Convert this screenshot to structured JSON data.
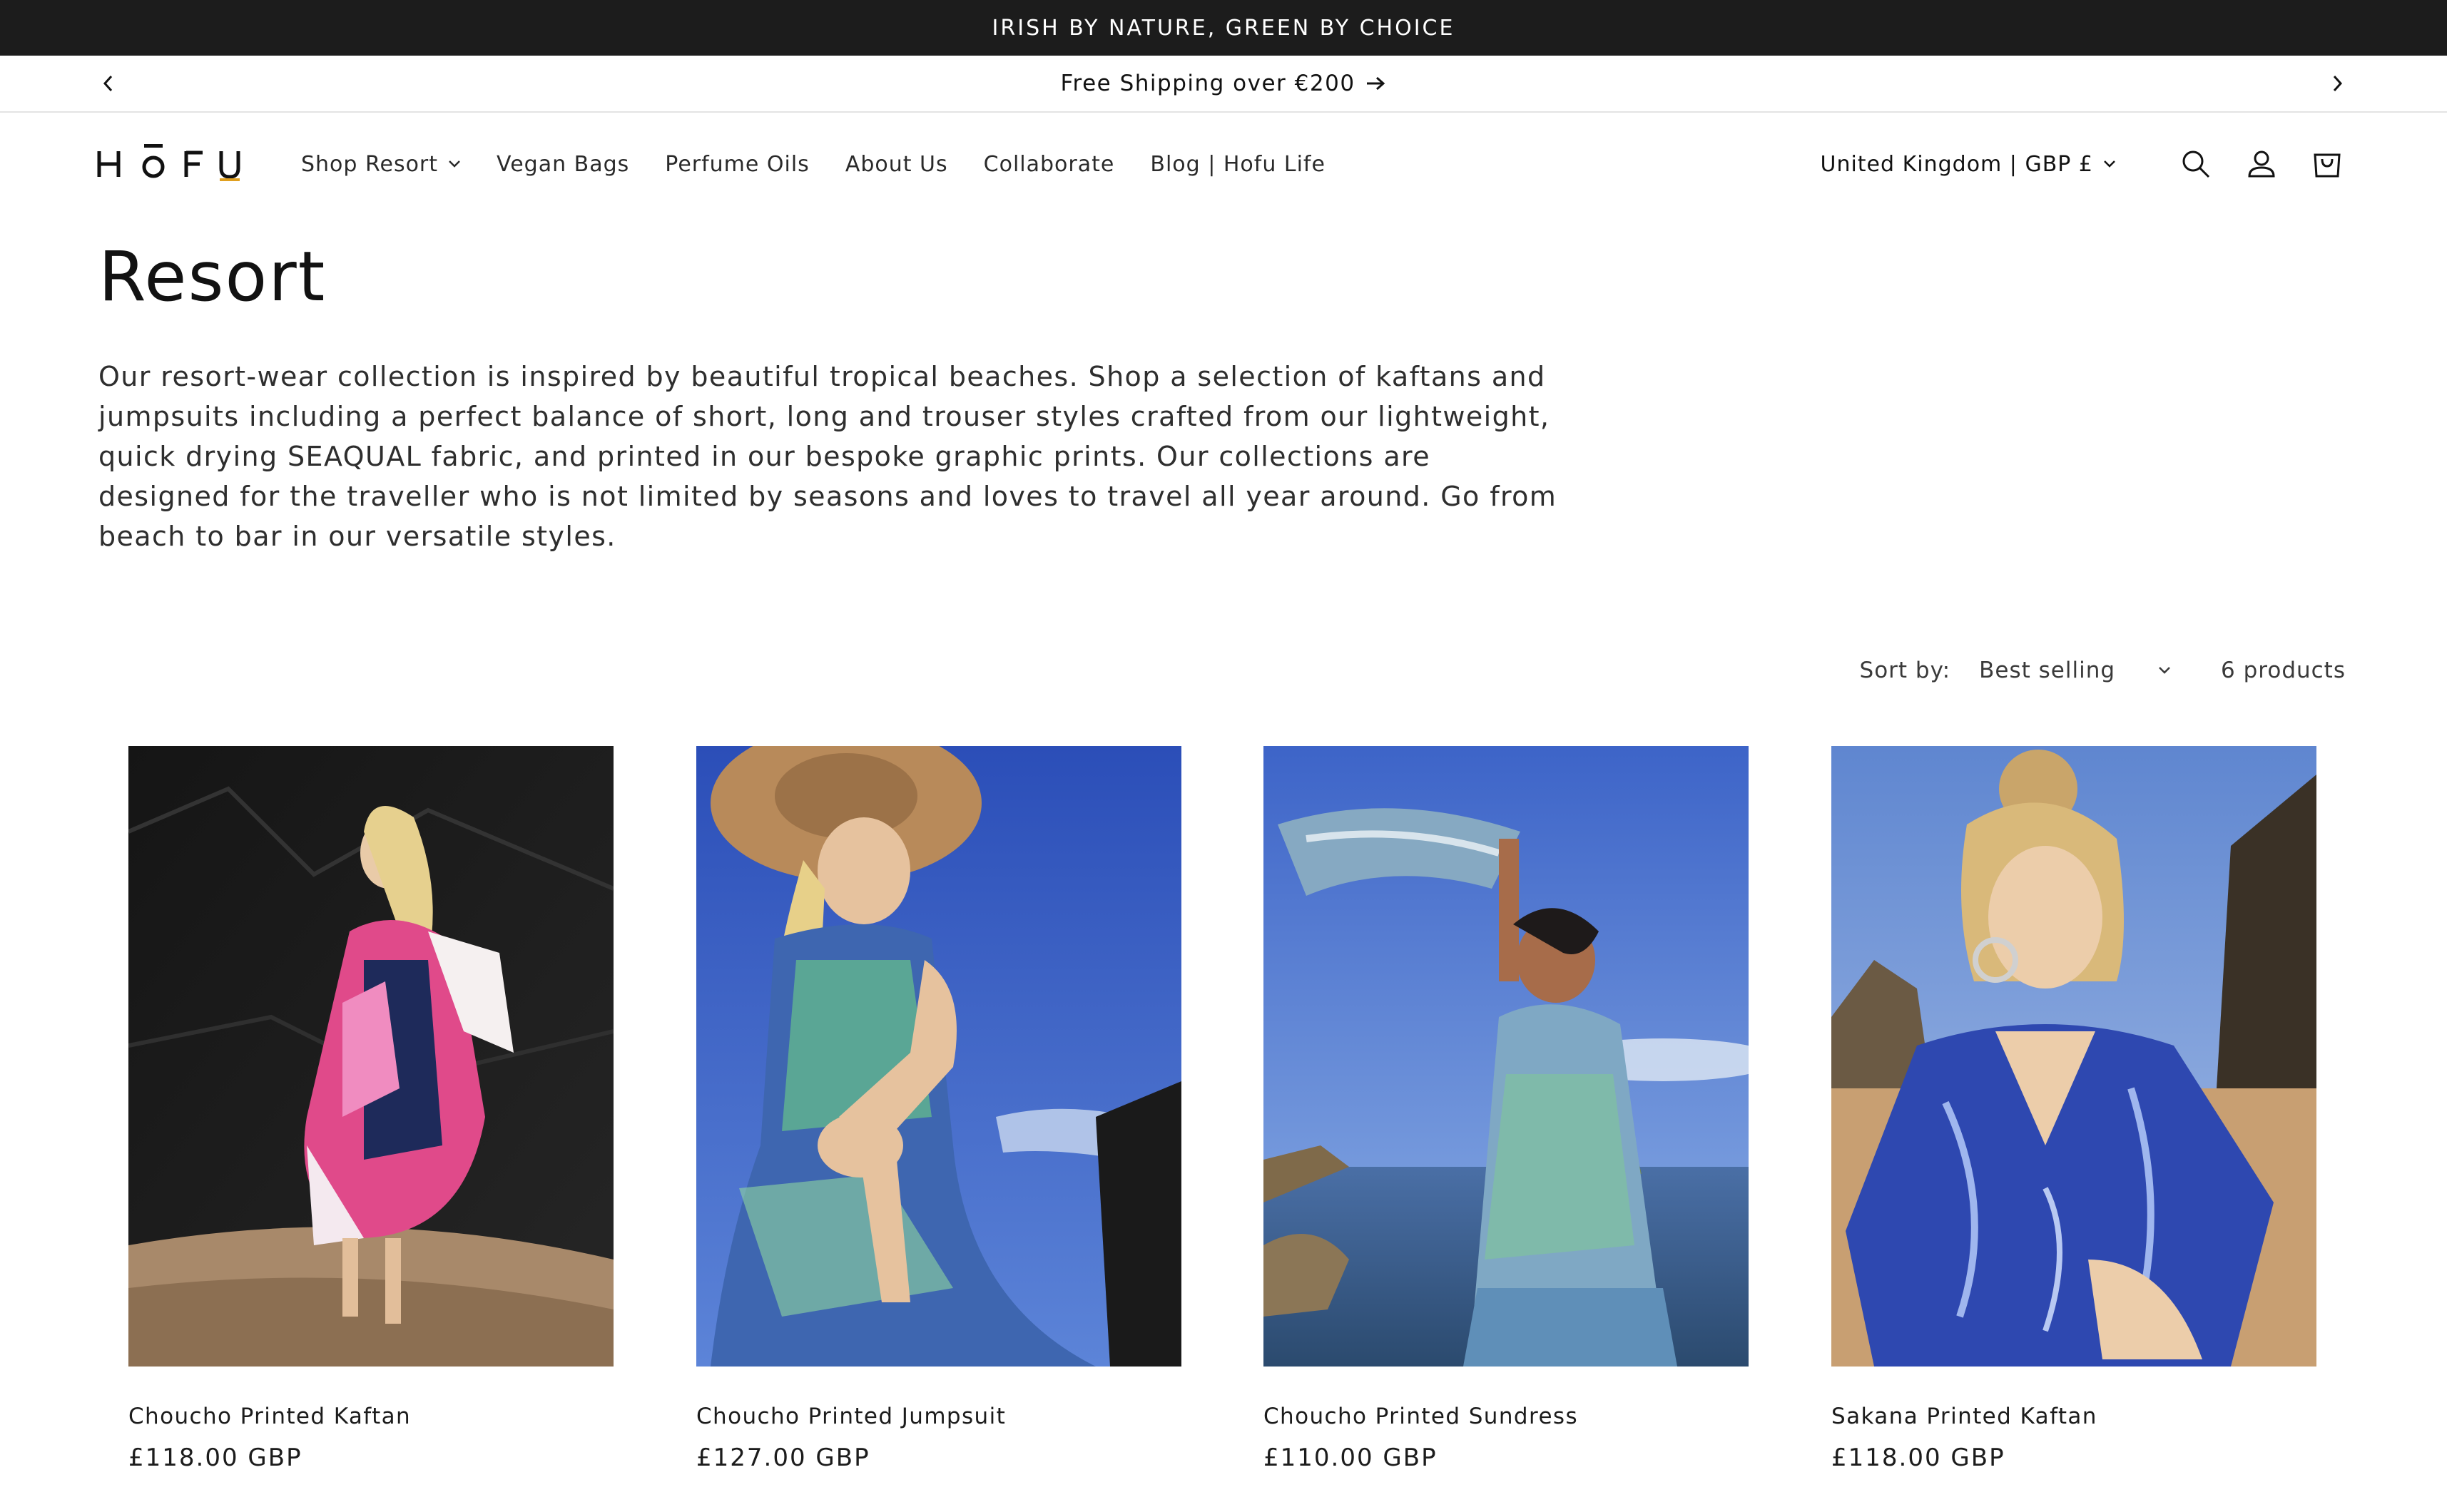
{
  "topbar": {
    "text": "IRISH BY NATURE, GREEN BY CHOICE"
  },
  "announcement": {
    "text": "Free Shipping over €200"
  },
  "brand": {
    "logo_text": "HŌFU",
    "accent_color": "#e0a020"
  },
  "nav": {
    "items": [
      {
        "label": "Shop Resort",
        "has_dropdown": true
      },
      {
        "label": "Vegan Bags"
      },
      {
        "label": "Perfume Oils"
      },
      {
        "label": "About Us"
      },
      {
        "label": "Collaborate"
      },
      {
        "label": "Blog | Hofu Life"
      }
    ]
  },
  "header": {
    "locale": "United Kingdom | GBP £",
    "icons": [
      "search-icon",
      "account-icon",
      "cart-icon"
    ]
  },
  "collection": {
    "title": "Resort",
    "description": "Our resort-wear collection is inspired by beautiful tropical beaches. Shop a selection of kaftans and jumpsuits including a perfect balance of short, long and trouser styles crafted from our lightweight, quick drying SEAQUAL fabric, and printed in our bespoke graphic prints. Our collections are designed for the traveller who is not limited by seasons and loves to travel all year around. Go from beach to bar in our versatile styles."
  },
  "sort": {
    "label": "Sort by:",
    "selected": "Best selling",
    "count": "6 products"
  },
  "products": [
    {
      "name": "Choucho Printed Kaftan",
      "price": "£118.00 GBP"
    },
    {
      "name": "Choucho Printed Jumpsuit",
      "price": "£127.00 GBP"
    },
    {
      "name": "Choucho Printed Sundress",
      "price": "£110.00 GBP"
    },
    {
      "name": "Sakana Printed Kaftan",
      "price": "£118.00 GBP"
    }
  ]
}
